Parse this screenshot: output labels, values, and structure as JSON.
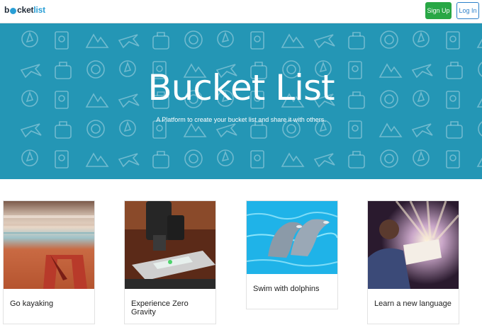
{
  "navbar": {
    "brand_part1": "b",
    "brand_part2": "cket",
    "brand_part3": "list",
    "signup_label": "Sign Up",
    "login_label": "Log In"
  },
  "hero": {
    "title": "Bucket List",
    "subtitle": "A Platform to create your bucket list and share it with others."
  },
  "cards": [
    {
      "title": "Go kayaking"
    },
    {
      "title": "Experience Zero Gravity"
    },
    {
      "title": "Swim with dolphins"
    },
    {
      "title": "Learn a new language"
    }
  ],
  "colors": {
    "hero_background": "#2496b5",
    "signup_button": "#28a745",
    "login_button": "#2a7fc9",
    "brand_accent": "#2a9fd6"
  }
}
